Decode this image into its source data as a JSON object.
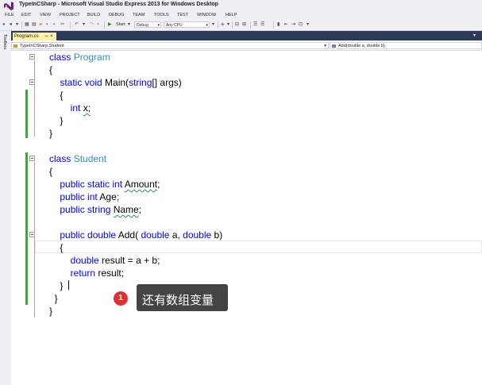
{
  "window": {
    "title": "TypeInCSharp - Microsoft Visual Studio Express 2013 for Windows Desktop",
    "icon": "visual-studio-logo-icon"
  },
  "menu": [
    "FILE",
    "EDIT",
    "VIEW",
    "PROJECT",
    "BUILD",
    "DEBUG",
    "TEAM",
    "TOOLS",
    "TEST",
    "WINDOW",
    "HELP"
  ],
  "toolbar": {
    "start_label": "Start",
    "configuration": "Debug",
    "platform": "Any CPU"
  },
  "toolbox_label": "Toolbox",
  "tabs": [
    {
      "label": "Program.cs",
      "active": true
    }
  ],
  "navigation": {
    "type_selector": "TypeInCSharp.Student",
    "member_selector": "Add(double a, double b)"
  },
  "code": {
    "lines": [
      [
        {
          "t": "class ",
          "c": "kw"
        },
        {
          "t": "Program",
          "c": "ty"
        }
      ],
      [
        {
          "t": "{",
          "c": ""
        }
      ],
      [
        {
          "t": "    ",
          "c": ""
        },
        {
          "t": "static void ",
          "c": "kw"
        },
        {
          "t": "Main(",
          "c": ""
        },
        {
          "t": "string",
          "c": "kw"
        },
        {
          "t": "[] args)",
          "c": ""
        }
      ],
      [
        {
          "t": "    {",
          "c": ""
        }
      ],
      [
        {
          "t": "        ",
          "c": ""
        },
        {
          "t": "int ",
          "c": "kw"
        },
        {
          "t": "x;",
          "c": "sq"
        }
      ],
      [
        {
          "t": "    }",
          "c": ""
        }
      ],
      [
        {
          "t": "}",
          "c": ""
        }
      ],
      [
        {
          "t": "",
          "c": ""
        }
      ],
      [
        {
          "t": "class ",
          "c": "kw"
        },
        {
          "t": "Student",
          "c": "ty"
        }
      ],
      [
        {
          "t": "{",
          "c": ""
        }
      ],
      [
        {
          "t": "    ",
          "c": ""
        },
        {
          "t": "public static int ",
          "c": "kw"
        },
        {
          "t": "Amount",
          "c": "sq"
        },
        {
          "t": ";",
          "c": ""
        }
      ],
      [
        {
          "t": "    ",
          "c": ""
        },
        {
          "t": "public int ",
          "c": "kw"
        },
        {
          "t": "Age;",
          "c": ""
        }
      ],
      [
        {
          "t": "    ",
          "c": ""
        },
        {
          "t": "public string ",
          "c": "kw"
        },
        {
          "t": "Name",
          "c": "sq"
        },
        {
          "t": ";",
          "c": ""
        }
      ],
      [
        {
          "t": "",
          "c": ""
        }
      ],
      [
        {
          "t": "    ",
          "c": ""
        },
        {
          "t": "public double ",
          "c": "kw"
        },
        {
          "t": "Add( ",
          "c": ""
        },
        {
          "t": "double ",
          "c": "kw"
        },
        {
          "t": "a, ",
          "c": ""
        },
        {
          "t": "double ",
          "c": "kw"
        },
        {
          "t": "b)",
          "c": ""
        }
      ],
      [
        {
          "t": "    {",
          "c": ""
        }
      ],
      [
        {
          "t": "        ",
          "c": ""
        },
        {
          "t": "double ",
          "c": "kw"
        },
        {
          "t": "result = a + b;",
          "c": ""
        }
      ],
      [
        {
          "t": "        ",
          "c": ""
        },
        {
          "t": "return ",
          "c": "kw"
        },
        {
          "t": "result;",
          "c": ""
        }
      ],
      [
        {
          "t": "    }",
          "c": ""
        }
      ],
      [
        {
          "t": "  }",
          "c": ""
        }
      ],
      [
        {
          "t": "}",
          "c": ""
        }
      ]
    ]
  },
  "annotation": {
    "badge": "1",
    "text": "还有数组变量"
  },
  "colors": {
    "keyword": "#0000ff",
    "type": "#2b91af",
    "tab_active": "#fff1a7",
    "tab_strip": "#2b3a58",
    "change_bar": "#3fa53f"
  }
}
